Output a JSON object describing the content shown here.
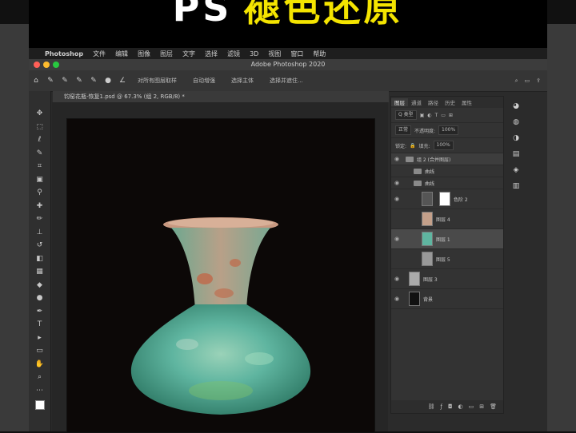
{
  "banner": {
    "prefix": "PS",
    "title": "褪色还原"
  },
  "menubar": {
    "app_name": "Photoshop",
    "items": [
      "文件",
      "编辑",
      "图像",
      "图层",
      "文字",
      "选择",
      "滤镜",
      "3D",
      "视图",
      "窗口",
      "帮助"
    ]
  },
  "window": {
    "title": "Adobe Photoshop 2020"
  },
  "options": {
    "opt1": "对所有图层取样",
    "opt2": "自动增强",
    "opt3": "选择主体",
    "opt4": "选择并遮住..."
  },
  "document": {
    "tab_title": "钧窑花瓶-恢复1.psd @ 67.3% (组 2, RGB/8) *"
  },
  "panel": {
    "tabs": [
      "图层",
      "通道",
      "路径",
      "历史",
      "属性"
    ],
    "kind_label": "Q 类型",
    "blend_mode": "正常",
    "opacity_label": "不透明度:",
    "opacity_value": "100%",
    "lock_label": "锁定:",
    "fill_label": "填充:",
    "fill_value": "100%",
    "layers": [
      {
        "name": "组 2 (合并图层)",
        "kind": "group-hdr"
      },
      {
        "name": "曲线",
        "kind": "folder"
      },
      {
        "name": "曲线",
        "kind": "folder"
      },
      {
        "name": "色阶 2",
        "kind": "adjust"
      },
      {
        "name": "图层 4",
        "kind": "pixel"
      },
      {
        "name": "图层 1",
        "kind": "pixel-selected"
      },
      {
        "name": "图层 5",
        "kind": "pixel"
      },
      {
        "name": "图层 3",
        "kind": "pixel"
      },
      {
        "name": "背景",
        "kind": "pixel"
      }
    ]
  },
  "colors": {
    "banner_text": "#f4e400",
    "vase_teal": "#5fb5a0",
    "vase_rust": "#c06848",
    "canvas_bg": "#0c0807"
  }
}
